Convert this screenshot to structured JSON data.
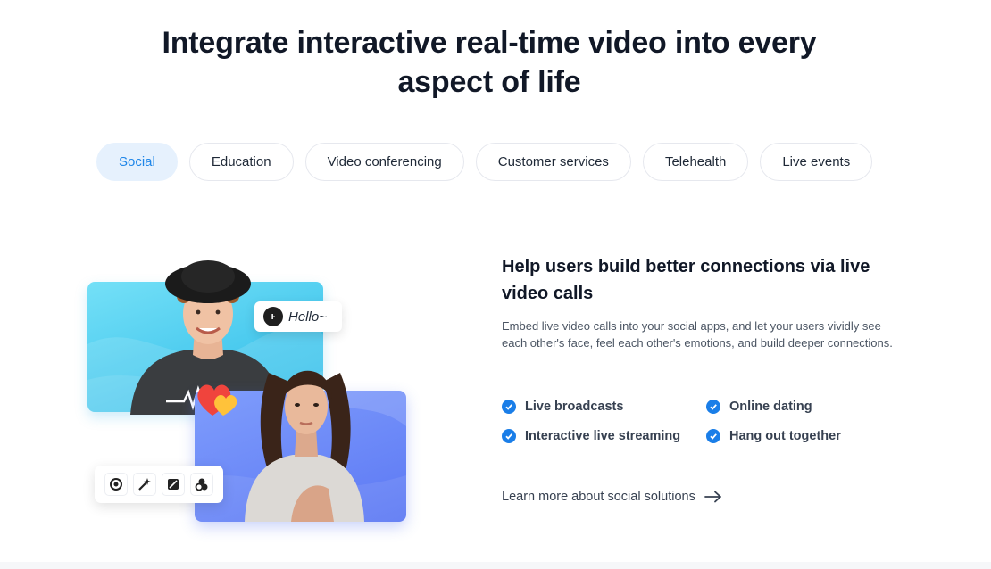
{
  "headline": {
    "line1": "Integrate interactive real-time video into every",
    "line2": "aspect of life"
  },
  "tabs": [
    {
      "label": "Social",
      "active": true
    },
    {
      "label": "Education",
      "active": false
    },
    {
      "label": "Video conferencing",
      "active": false
    },
    {
      "label": "Customer services",
      "active": false
    },
    {
      "label": "Telehealth",
      "active": false
    },
    {
      "label": "Live events",
      "active": false
    }
  ],
  "illustration": {
    "bubble_text": "Hello~",
    "bubble_icon": "chat-face-icon",
    "tools": [
      "camera-flip-icon",
      "beauty-wand-icon",
      "filter-icon",
      "effects-icon"
    ]
  },
  "section": {
    "title": "Help users build better connections via live video calls",
    "description": "Embed live video calls into your social apps, and let your users vividly see each other's face, feel each other's emotions, and build deeper connections."
  },
  "features": [
    "Live broadcasts",
    "Online dating",
    "Interactive live streaming",
    "Hang out together"
  ],
  "learn_more": {
    "label": "Learn more about social solutions",
    "icon": "arrow-right-icon"
  },
  "colors": {
    "accent": "#1a7ee8",
    "active_tab_bg": "#e6f1fd",
    "card_cyan": "#48c9ee",
    "card_blue": "#5c78f4",
    "heading": "#111827"
  }
}
